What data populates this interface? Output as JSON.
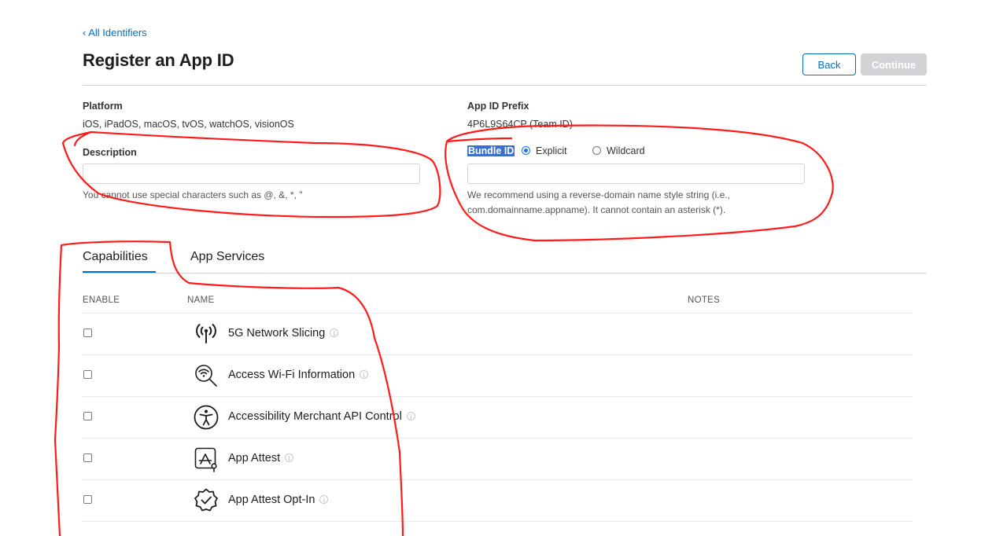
{
  "header": {
    "back_link": "‹ All Identifiers",
    "title": "Register an App ID",
    "back_button": "Back",
    "continue_button": "Continue"
  },
  "platform": {
    "label": "Platform",
    "value": "iOS, iPadOS, macOS, tvOS, watchOS, visionOS"
  },
  "prefix": {
    "label": "App ID Prefix",
    "value": "4P6L9S64CP (Team ID)"
  },
  "description": {
    "label": "Description",
    "value": "",
    "hint": "You cannot use special characters such as @, &, *, \""
  },
  "bundle": {
    "label": "Bundle ID",
    "options": [
      "Explicit",
      "Wildcard"
    ],
    "selected": "Explicit",
    "value": "",
    "hint_line1": "We recommend using a reverse-domain name style string (i.e.,",
    "hint_line2": "com.domainname.appname). It cannot contain an asterisk (*)."
  },
  "tabs": [
    {
      "label": "Capabilities",
      "active": true
    },
    {
      "label": "App Services",
      "active": false
    }
  ],
  "table": {
    "columns": [
      "ENABLE",
      "NAME",
      "NOTES"
    ],
    "rows": [
      {
        "name": "5G Network Slicing",
        "icon": "antenna-icon",
        "checked": false
      },
      {
        "name": "Access Wi-Fi Information",
        "icon": "wifi-search-icon",
        "checked": false
      },
      {
        "name": "Accessibility Merchant API Control",
        "icon": "accessibility-icon",
        "checked": false
      },
      {
        "name": "App Attest",
        "icon": "app-attest-icon",
        "checked": false
      },
      {
        "name": "App Attest Opt-In",
        "icon": "verified-badge-icon",
        "checked": false
      }
    ]
  },
  "colors": {
    "accent": "#0070c9",
    "annotation": "#ff1a1a",
    "selection": "#3a6fd0"
  }
}
